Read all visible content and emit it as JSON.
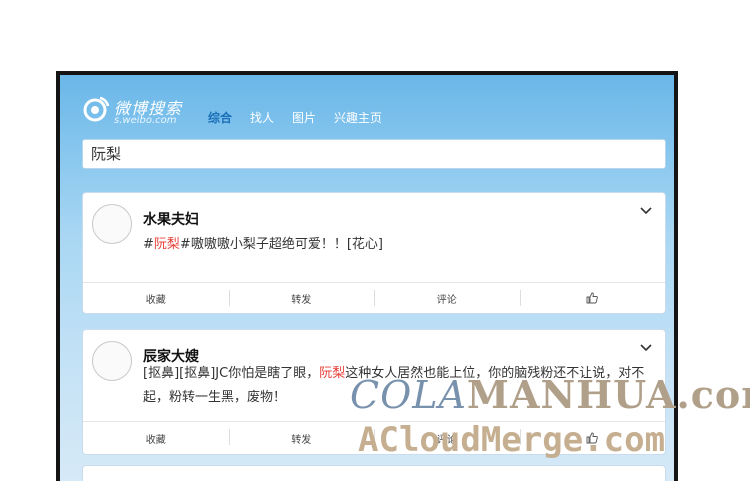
{
  "app": {
    "logo_title": "微博搜索",
    "logo_url": "s.weibo.com"
  },
  "nav": {
    "tabs": [
      "综合",
      "找人",
      "图片",
      "兴趣主页"
    ],
    "active": "综合"
  },
  "search": {
    "value": "阮梨"
  },
  "posts": [
    {
      "author": "水果夫妇",
      "segments": [
        "#",
        "阮梨",
        "#嗷嗷嗷小梨子超绝可爱！！[花心]"
      ]
    },
    {
      "author": "辰家大嫂",
      "segments": [
        "[抠鼻][抠鼻]JC你怕是瞎了眼，",
        "阮梨",
        "这种女人居然也能上位，你的脑残粉还不让说，对不起，粉转一生黑，废物！"
      ]
    }
  ],
  "actions": {
    "collect": "收藏",
    "repost": "转发",
    "comment": "评论",
    "like_icon": "thumbs-up-icon"
  },
  "watermark": {
    "line1_a": "COLA",
    "line1_b": "MANHUA.com",
    "line2": "ACloudMerge.com"
  },
  "colors": {
    "highlight": "#e8403a",
    "active_tab": "#1b6fb7",
    "bg_top": "#69b6e8"
  }
}
